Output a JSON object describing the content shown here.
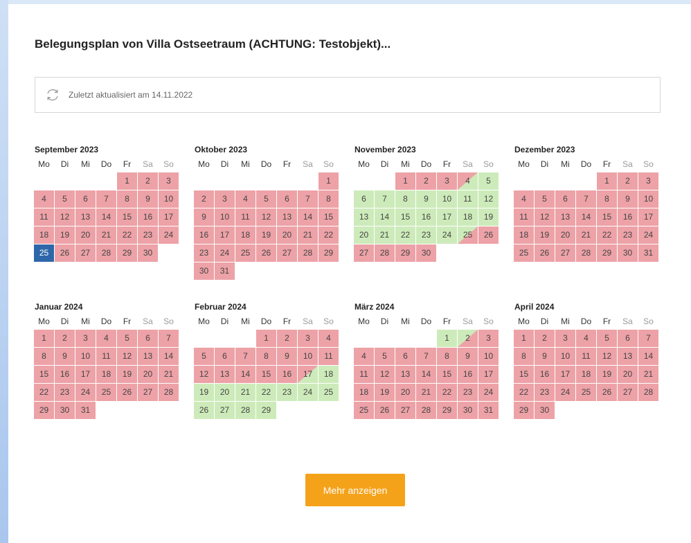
{
  "page": {
    "title": "Belegungsplan von Villa Ostseetraum (ACHTUNG: Testobjekt)...",
    "updated_text": "Zuletzt aktualisiert am 14.11.2022",
    "more_button": "Mehr anzeigen",
    "weekdays": [
      "Mo",
      "Di",
      "Mi",
      "Do",
      "Fr",
      "Sa",
      "So"
    ],
    "legend_colors": {
      "booked": "#eda2a7",
      "free": "#cdebba",
      "selected": "#2e67a9",
      "button": "#f5a21b"
    }
  },
  "months": [
    {
      "name": "September 2023",
      "offset": 4,
      "days": 30,
      "free": [],
      "arrive": [],
      "depart": [],
      "selected": [
        25
      ]
    },
    {
      "name": "Oktober 2023",
      "offset": 6,
      "days": 31,
      "free": [],
      "arrive": [],
      "depart": [],
      "selected": []
    },
    {
      "name": "November 2023",
      "offset": 2,
      "days": 30,
      "free": [
        5,
        6,
        7,
        8,
        9,
        10,
        11,
        12,
        13,
        14,
        15,
        16,
        17,
        18,
        19,
        20,
        21,
        22,
        23,
        24
      ],
      "arrive": [
        25
      ],
      "depart": [
        4
      ],
      "selected": []
    },
    {
      "name": "Dezember 2023",
      "offset": 4,
      "days": 31,
      "free": [],
      "arrive": [],
      "depart": [],
      "selected": []
    },
    {
      "name": "Januar 2024",
      "offset": 0,
      "days": 31,
      "free": [],
      "arrive": [],
      "depart": [],
      "selected": []
    },
    {
      "name": "Februar 2024",
      "offset": 3,
      "days": 29,
      "free": [
        18,
        19,
        20,
        21,
        22,
        23,
        24,
        25,
        26,
        27,
        28,
        29
      ],
      "arrive": [],
      "depart": [
        17
      ],
      "selected": []
    },
    {
      "name": "März 2024",
      "offset": 4,
      "days": 31,
      "free": [
        1
      ],
      "arrive": [
        2
      ],
      "depart": [],
      "selected": []
    },
    {
      "name": "April 2024",
      "offset": 0,
      "days": 30,
      "free": [],
      "arrive": [],
      "depart": [],
      "selected": []
    }
  ]
}
